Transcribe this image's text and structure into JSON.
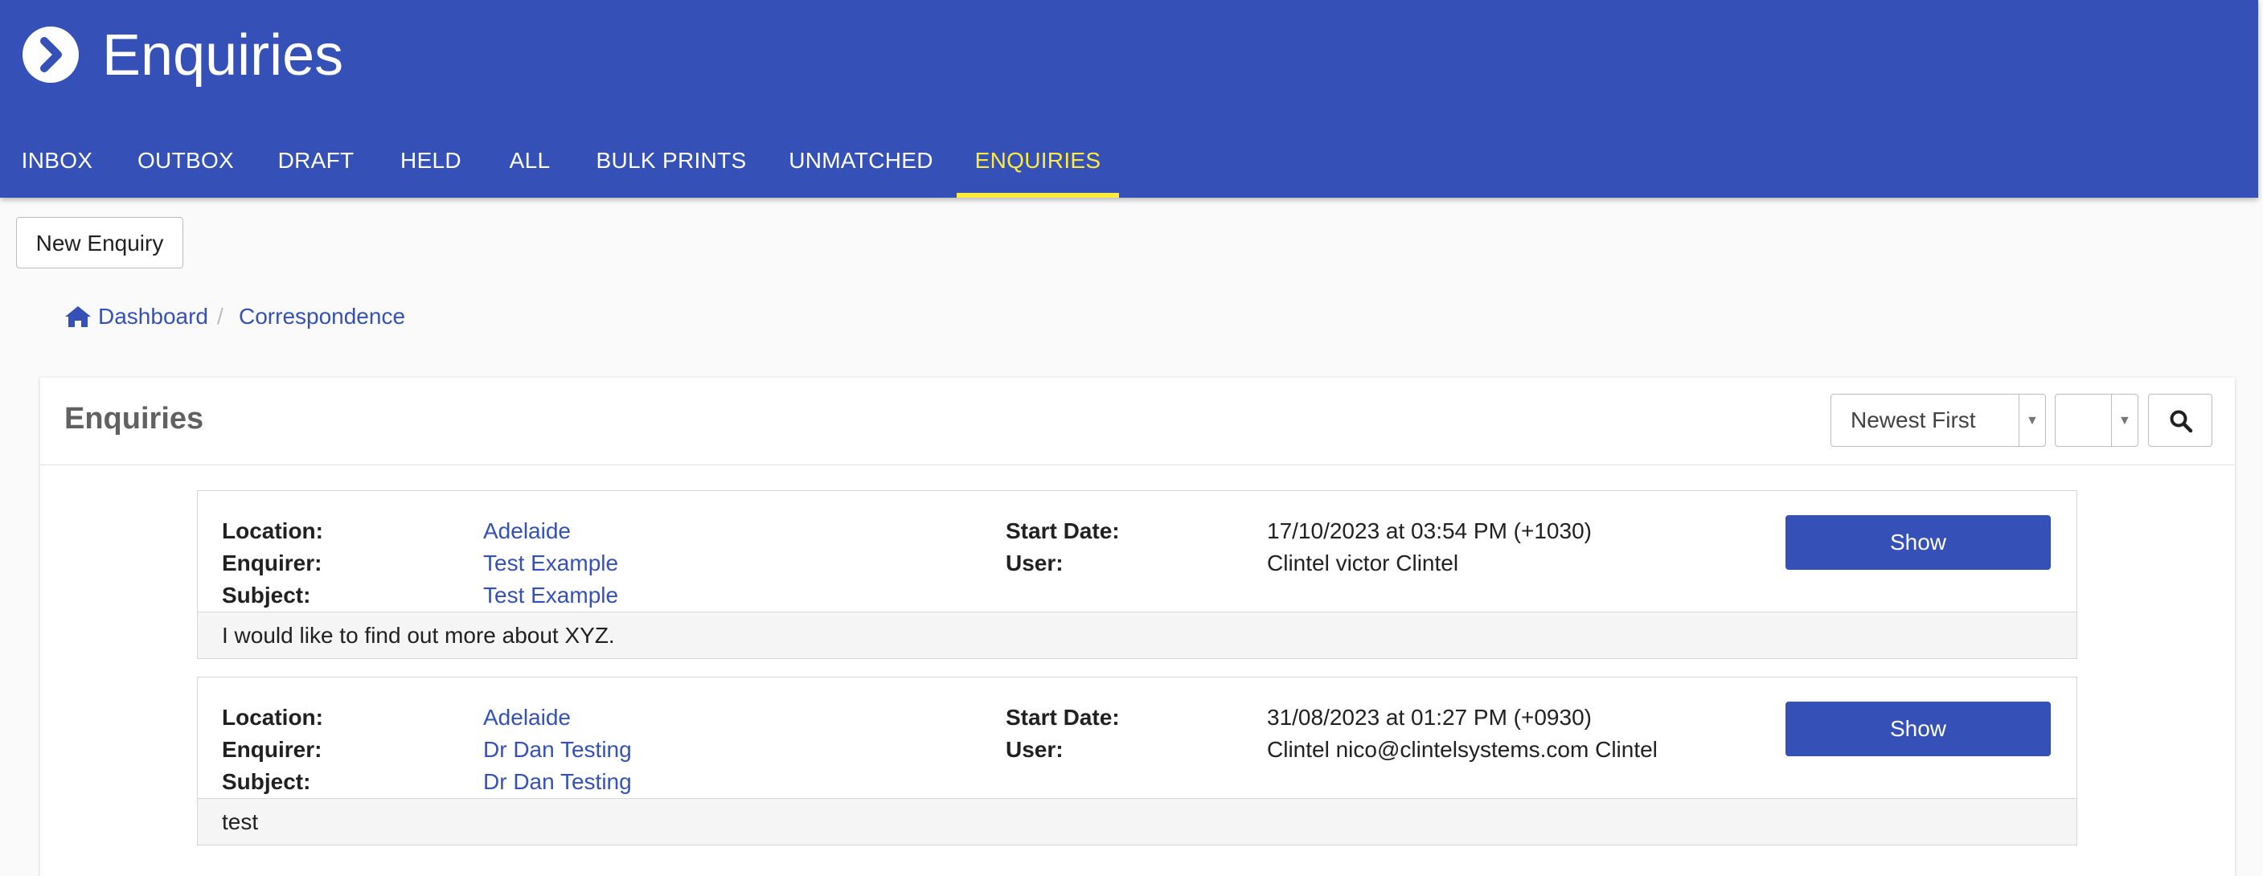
{
  "header": {
    "title": "Enquiries",
    "tabs": [
      {
        "label": "INBOX",
        "active": false
      },
      {
        "label": "OUTBOX",
        "active": false
      },
      {
        "label": "DRAFT",
        "active": false
      },
      {
        "label": "HELD",
        "active": false
      },
      {
        "label": "ALL",
        "active": false
      },
      {
        "label": "BULK PRINTS",
        "active": false
      },
      {
        "label": "UNMATCHED",
        "active": false
      },
      {
        "label": "ENQUIRIES",
        "active": true
      }
    ]
  },
  "toolbar": {
    "new_enquiry_label": "New Enquiry"
  },
  "breadcrumb": [
    {
      "label": "Dashboard",
      "icon": "home-icon"
    },
    {
      "label": "Correspondence"
    }
  ],
  "panel": {
    "title": "Enquiries",
    "sort_value": "Newest First",
    "filter_value": ""
  },
  "labels": {
    "location": "Location:",
    "enquirer": "Enquirer:",
    "subject": "Subject:",
    "start_date": "Start Date:",
    "user": "User:",
    "show": "Show"
  },
  "enquiries": [
    {
      "location": "Adelaide",
      "enquirer": "Test Example",
      "subject": "Test Example",
      "start_date": "17/10/2023 at 03:54 PM (+1030)",
      "user": "Clintel victor Clintel",
      "message": "I would like to find out more about XYZ."
    },
    {
      "location": "Adelaide",
      "enquirer": "Dr Dan Testing",
      "subject": "Dr Dan Testing",
      "start_date": "31/08/2023 at 01:27 PM (+0930)",
      "user": "Clintel nico@clintelsystems.com Clintel",
      "message": "test"
    }
  ],
  "colors": {
    "primary": "#3551b8",
    "active_tab": "#ffeb3b"
  }
}
